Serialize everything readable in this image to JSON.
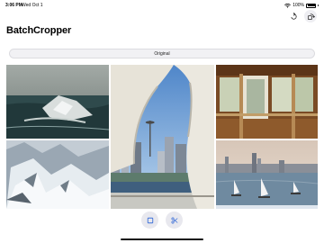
{
  "status_bar": {
    "time": "3:06 PM",
    "date": "Wed Oct 1",
    "battery": "100%",
    "icons": [
      "wifi-icon",
      "battery-icon"
    ]
  },
  "toolbar": {
    "undo_icon": "undo-icon",
    "rotate_icon": "rotate-icon"
  },
  "app": {
    "title": "BatchCropper"
  },
  "segment": {
    "selected": "Original"
  },
  "photos": [
    {
      "name": "ocean-waves-photo"
    },
    {
      "name": "ferry-seattle-photo"
    },
    {
      "name": "train-interior-photo"
    },
    {
      "name": "snowy-mountains-photo"
    },
    {
      "name": "harbor-sailboats-photo"
    }
  ],
  "bottom_tools": {
    "square_icon": "square-icon",
    "crop_icon": "scissors-icon"
  },
  "colors": {
    "accent": "#3b6fd8",
    "button_bg": "#e8e8ee"
  }
}
